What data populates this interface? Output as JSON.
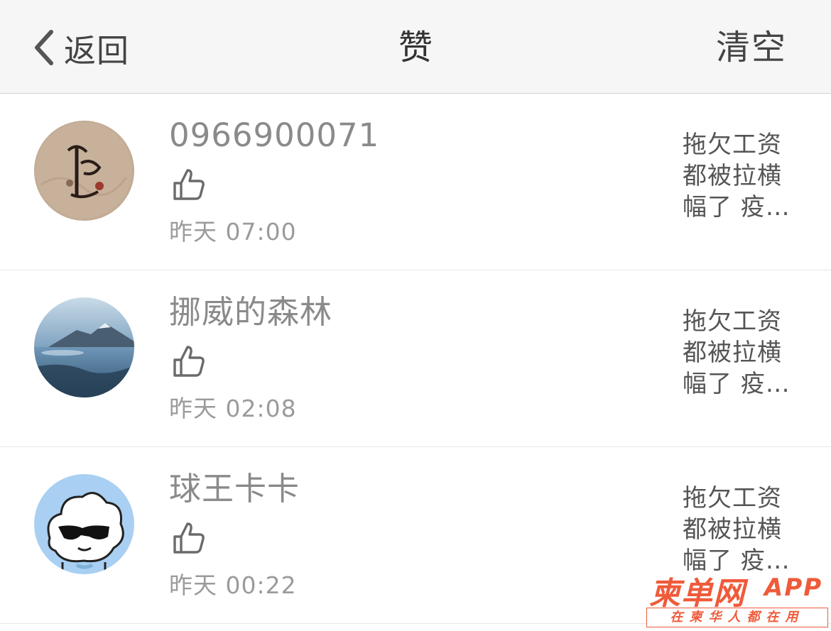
{
  "nav": {
    "back_label": "返回",
    "title": "赞",
    "clear_label": "清空"
  },
  "notifications": [
    {
      "username": "0966900071",
      "time": "昨天 07:00",
      "snippet": "拖欠工资都被拉横幅了 疫…",
      "avatar_icon": "calligraphy-avatar"
    },
    {
      "username": "挪威的森林",
      "time": "昨天 02:08",
      "snippet": "拖欠工资都被拉横幅了 疫…",
      "avatar_icon": "landscape-avatar"
    },
    {
      "username": "球王卡卡",
      "time": "昨天 00:22",
      "snippet": "拖欠工资都被拉横幅了 疫…",
      "avatar_icon": "cloud-sunglasses-avatar"
    }
  ],
  "watermark": {
    "logo": "柬单网",
    "app": "APP",
    "slogan": "在柬华人都在用"
  },
  "colors": {
    "nav_background": "#f6f6f6",
    "text_gray": "#8a8a8a",
    "watermark_orange": "#ef5b3a"
  }
}
